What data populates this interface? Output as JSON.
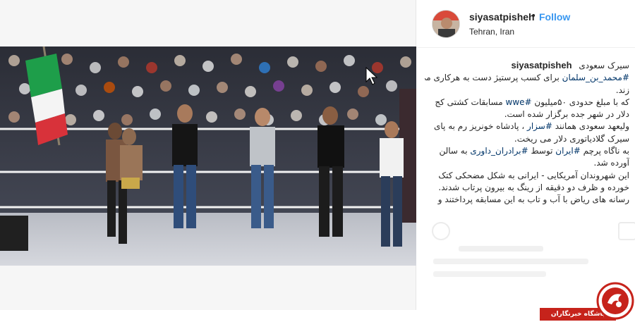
{
  "post": {
    "username": "siyasatpisheh",
    "separator": "•",
    "follow_label": "Follow",
    "location": "Tehran, Iran"
  },
  "caption": {
    "username": "siyasatpisheh",
    "title": "سیرک سعودی",
    "lines": [
      {
        "hashtag": "#محمد_بن_سلمان",
        "text": " برای کسب پرستیژ دست به هرکاری می"
      },
      {
        "text": "زند."
      },
      {
        "text": "که با مبلغ حدودی ۵۰میلیون ",
        "hashtag": "#wwe",
        "text2": " مسابقات کشتی کج"
      },
      {
        "text": "دلار در شهر جده برگزار شده است."
      },
      {
        "text": "ولیعهد سعودی همانند ",
        "hashtag": "#سزار",
        "text2": " ، پادشاه خونریز رم به پای"
      },
      {
        "text": "سیرک گلادیاتوری دلار می ریخت."
      },
      {
        "text": "به ناگاه پرچم ",
        "hashtag": "#ایران",
        "text2": " توسط  ",
        "hashtag2": "#برادران_داوری",
        "text3": " به سالن"
      },
      {
        "text": "آورده شد."
      },
      {
        "text": "این شهروندان آمریکایی - ایرانی به شکل مضحکی کتک"
      },
      {
        "text": "خورده و ظرف دو دقیقه از رینگ به بیرون پرتاب شدند."
      },
      {
        "text": "رسانه های ریاض با آب و تاب به این مسابقه پرداختند و"
      }
    ]
  },
  "watermark": {
    "label": "باشگاه خبرنگاران"
  },
  "icons": {
    "avatar": "profile-photo",
    "media": "wrestling-ring-photo",
    "logo": "brand-logo"
  },
  "colors": {
    "follow": "#3897f0",
    "hashtag": "#003569",
    "watermark_band": "#c6231b"
  }
}
